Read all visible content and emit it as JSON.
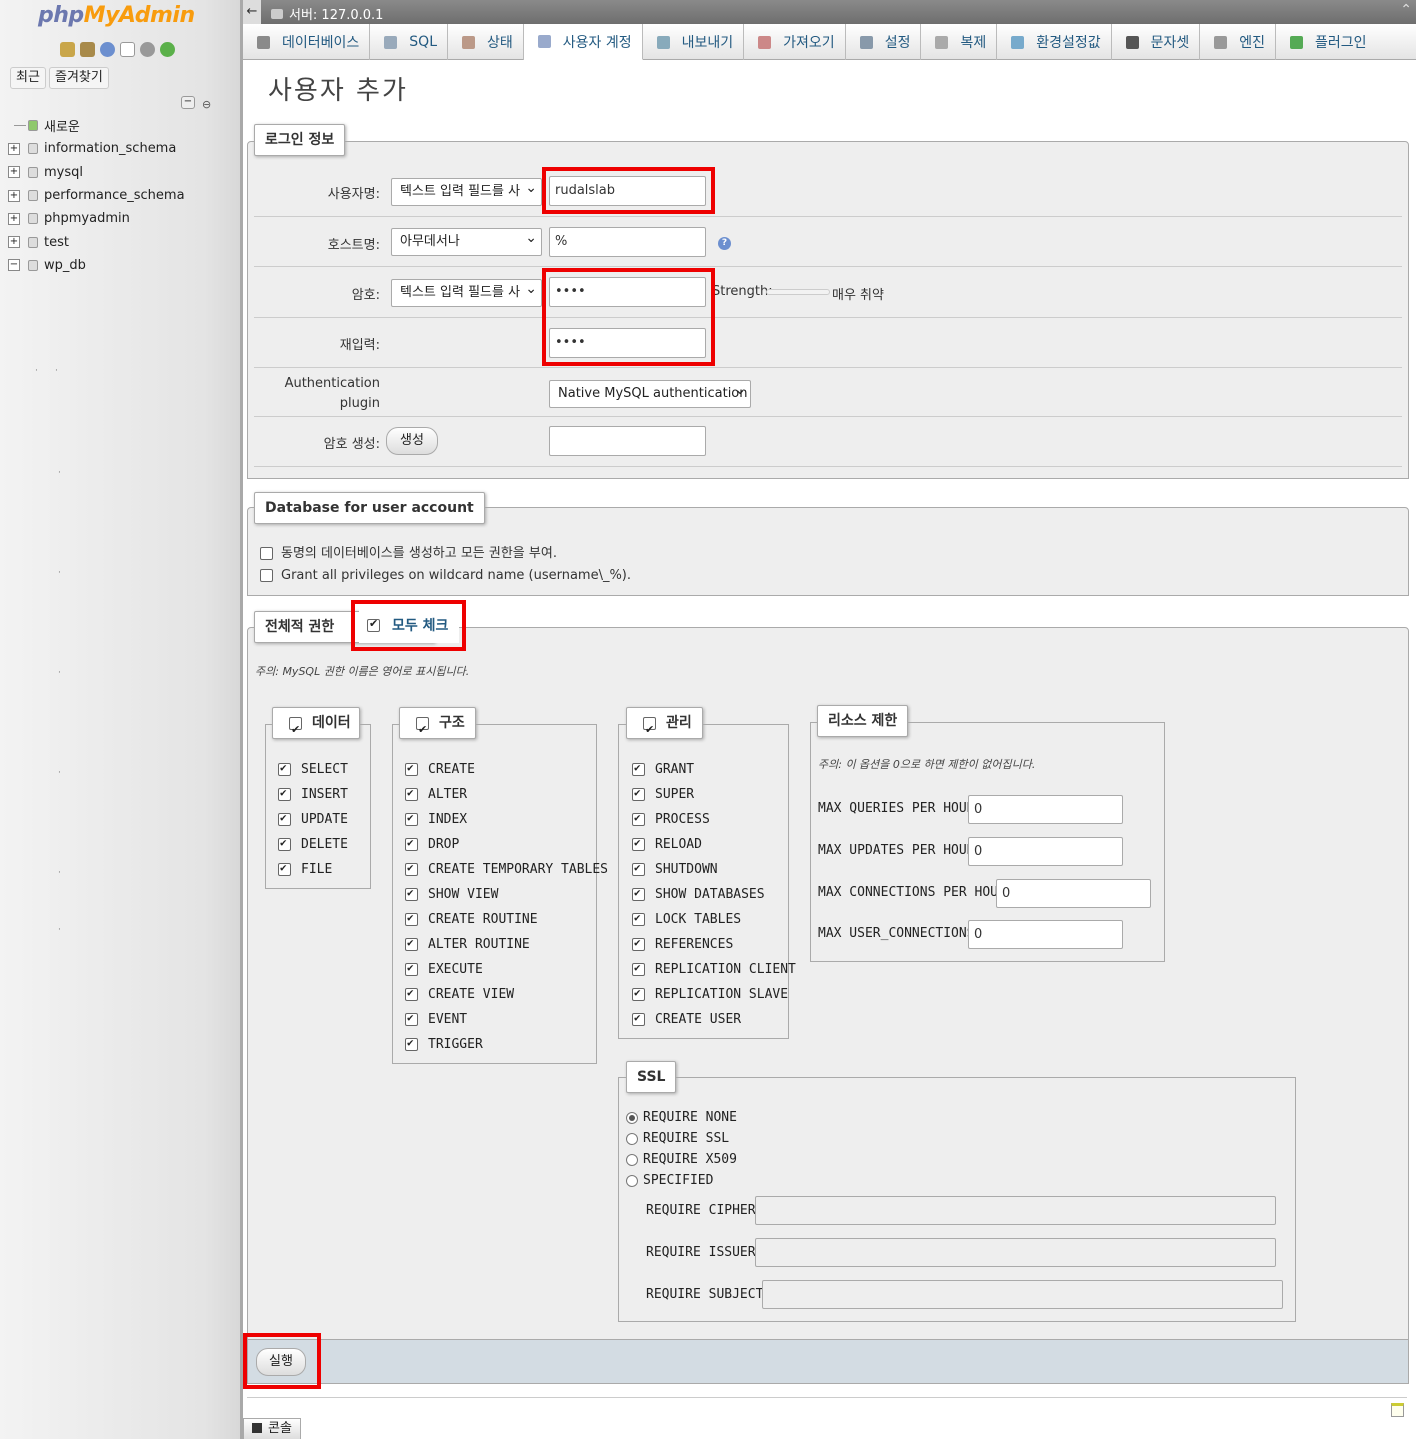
{
  "sidebar": {
    "logo": {
      "php": "php",
      "my": "My",
      "admin": "Admin"
    },
    "recent_button": "최근",
    "favorites_button": "즐겨찾기",
    "tree": [
      {
        "label": "새로운",
        "expander": ""
      },
      {
        "label": "information_schema",
        "expander": "+"
      },
      {
        "label": "mysql",
        "expander": "+"
      },
      {
        "label": "performance_schema",
        "expander": "+"
      },
      {
        "label": "phpmyadmin",
        "expander": "+"
      },
      {
        "label": "test",
        "expander": "+"
      },
      {
        "label": "wp_db",
        "expander": "−"
      }
    ]
  },
  "topbar": {
    "server": "서버: 127.0.0.1"
  },
  "tabs": [
    {
      "label": "데이터베이스",
      "icon": "database-icon"
    },
    {
      "label": "SQL",
      "icon": "sql-icon"
    },
    {
      "label": "상태",
      "icon": "status-icon"
    },
    {
      "label": "사용자 계정",
      "icon": "user-accounts-icon"
    },
    {
      "label": "내보내기",
      "icon": "export-icon"
    },
    {
      "label": "가져오기",
      "icon": "import-icon"
    },
    {
      "label": "설정",
      "icon": "settings-icon"
    },
    {
      "label": "복제",
      "icon": "replication-icon"
    },
    {
      "label": "환경설정값",
      "icon": "variables-icon"
    },
    {
      "label": "문자셋",
      "icon": "charset-icon"
    },
    {
      "label": "엔진",
      "icon": "engine-icon"
    },
    {
      "label": "플러그인",
      "icon": "plugin-icon"
    }
  ],
  "page_title": "사용자 추가",
  "login": {
    "legend": "로그인 정보",
    "username_label": "사용자명:",
    "username_mode": "텍스트 입력 필드를 사",
    "username_value": "rudalslab",
    "host_label": "호스트명:",
    "host_mode": "아무데서나",
    "host_value": "%",
    "password_label": "암호:",
    "password_mode": "텍스트 입력 필드를 사",
    "password_value": "••••",
    "strength_label": "Strength:",
    "strength_value": "매우 취약",
    "retype_label": "재입력:",
    "retype_value": "••••",
    "auth_label_1": "Authentication",
    "auth_label_2": "plugin",
    "auth_value": "Native MySQL authentication",
    "generate_label": "암호 생성:",
    "generate_button": "생성"
  },
  "database": {
    "legend": "Database for user account",
    "option1": "동명의 데이터베이스를 생성하고 모든 권한을 부여.",
    "option2": "Grant all privileges on wildcard name (username\\_%)."
  },
  "global_privs": {
    "legend": "전체적 권한",
    "check_all": "모두 체크",
    "note": "주의: MySQL 권한 이름은 영어로 표시됩니다.",
    "data": {
      "legend": "데이터",
      "items": [
        "SELECT",
        "INSERT",
        "UPDATE",
        "DELETE",
        "FILE"
      ]
    },
    "structure": {
      "legend": "구조",
      "items": [
        "CREATE",
        "ALTER",
        "INDEX",
        "DROP",
        "CREATE TEMPORARY TABLES",
        "SHOW VIEW",
        "CREATE ROUTINE",
        "ALTER ROUTINE",
        "EXECUTE",
        "CREATE VIEW",
        "EVENT",
        "TRIGGER"
      ]
    },
    "admin": {
      "legend": "관리",
      "items": [
        "GRANT",
        "SUPER",
        "PROCESS",
        "RELOAD",
        "SHUTDOWN",
        "SHOW DATABASES",
        "LOCK TABLES",
        "REFERENCES",
        "REPLICATION CLIENT",
        "REPLICATION SLAVE",
        "CREATE USER"
      ]
    },
    "resource": {
      "legend": "리소스 제한",
      "note": "주의: 이 옵션을 0으로 하면 제한이 없어집니다.",
      "items": [
        {
          "label": "MAX QUERIES PER HOUR",
          "value": "0"
        },
        {
          "label": "MAX UPDATES PER HOUR",
          "value": "0"
        },
        {
          "label": "MAX CONNECTIONS PER HOUR",
          "value": "0"
        },
        {
          "label": "MAX USER_CONNECTIONS",
          "value": "0"
        }
      ]
    },
    "ssl": {
      "legend": "SSL",
      "options": [
        "REQUIRE NONE",
        "REQUIRE SSL",
        "REQUIRE X509",
        "SPECIFIED"
      ],
      "fields": [
        "REQUIRE CIPHER",
        "REQUIRE ISSUER",
        "REQUIRE SUBJECT"
      ]
    }
  },
  "submit_button": "실행",
  "console_label": "콘솔"
}
